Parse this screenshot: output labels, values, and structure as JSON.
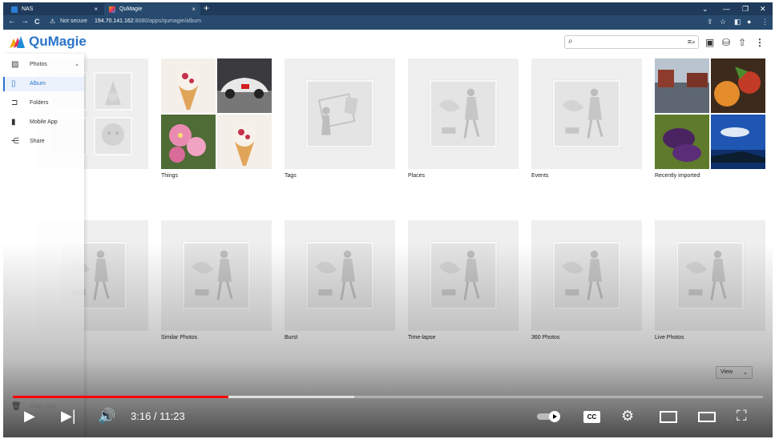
{
  "browser": {
    "tabs": [
      {
        "title": "NAS",
        "close": "×"
      },
      {
        "title": "QuMagie",
        "close": "×"
      }
    ],
    "new_tab": "+",
    "window_controls": [
      "⌄",
      "—",
      "❐",
      "✕"
    ],
    "nav": {
      "back": "←",
      "forward": "→",
      "reload": "C"
    },
    "security_label": "Not secure",
    "url_host": "194.70.141.162",
    "url_path": ":8080/apps/qumagie/album"
  },
  "app": {
    "brand": "QuMagie",
    "search_placeholder": "",
    "header_icons": [
      "advanced-search-icon",
      "image-search-icon",
      "smart-import-icon",
      "upload-icon",
      "more-icon"
    ]
  },
  "sidebar": {
    "items": [
      {
        "label": "Photos",
        "icon": "photos-icon",
        "expandable": true
      },
      {
        "label": "Album",
        "icon": "album-icon",
        "active": true
      },
      {
        "label": "Folders",
        "icon": "folder-icon"
      },
      {
        "label": "Mobile App",
        "icon": "mobile-icon"
      },
      {
        "label": "Share",
        "icon": "share-icon"
      }
    ],
    "trash": "Trash Can"
  },
  "albums": {
    "row1": [
      {
        "label": ""
      },
      {
        "label": "Things"
      },
      {
        "label": "Tags"
      },
      {
        "label": "Places"
      },
      {
        "label": "Events"
      },
      {
        "label": "Recently imported"
      }
    ],
    "row2": [
      {
        "label": ""
      },
      {
        "label": "Similar Photos"
      },
      {
        "label": "Burst"
      },
      {
        "label": "Time-lapse"
      },
      {
        "label": "360 Photos"
      },
      {
        "label": "Live Photos"
      }
    ]
  },
  "view_button": "View",
  "player": {
    "time": "3:16 / 11:23",
    "played_fraction": 0.287,
    "buffered_fraction": 0.455,
    "cc": "CC",
    "accent_color": "#ff0000"
  },
  "colors": {
    "brand": "#2a73c9",
    "chrome": "#274a6e"
  }
}
